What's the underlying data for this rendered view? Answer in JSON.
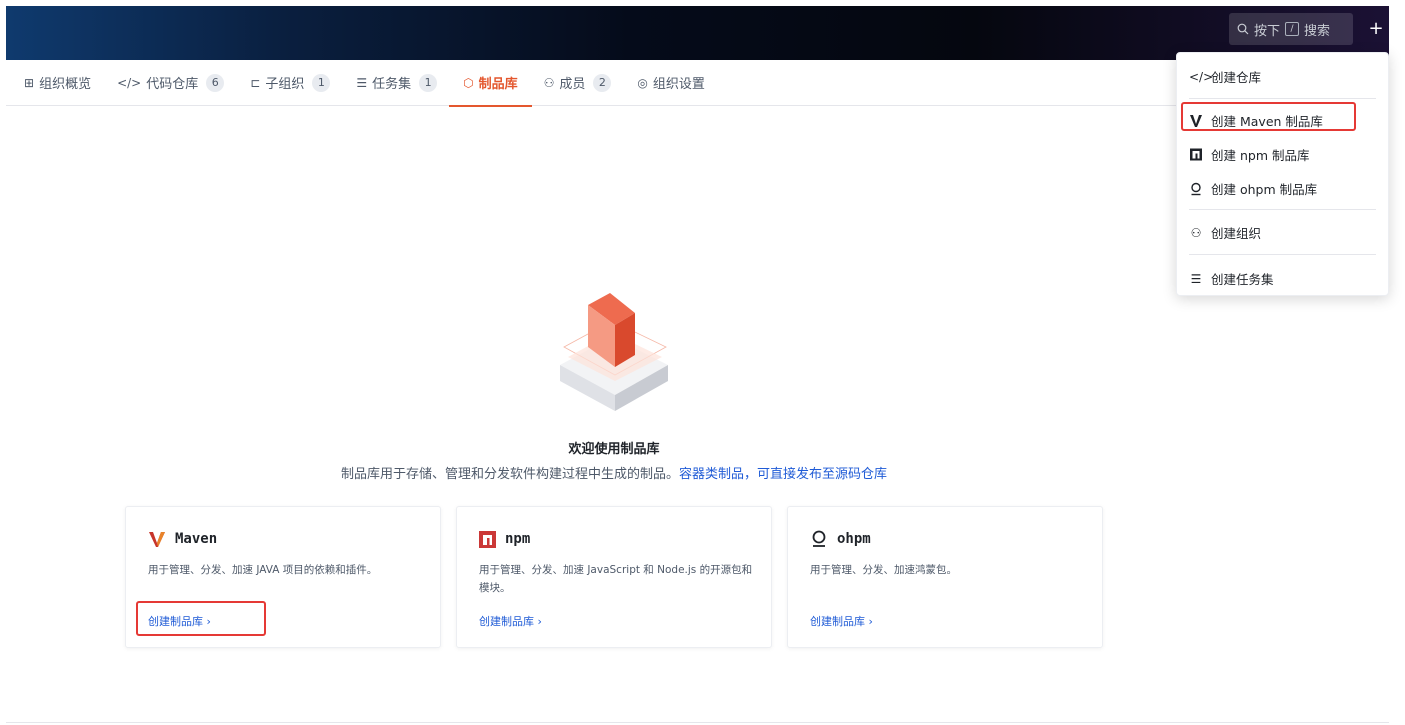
{
  "topbar": {
    "search_label": "按下",
    "search_key": "/",
    "search_text": "搜索",
    "plus_label": "+"
  },
  "tabs": [
    {
      "label": "组织概览",
      "icon": "grid-icon"
    },
    {
      "label": "代码仓库",
      "icon": "code-icon",
      "badge": "6"
    },
    {
      "label": "子组织",
      "icon": "hierarchy-icon",
      "badge": "1"
    },
    {
      "label": "任务集",
      "icon": "list-icon",
      "badge": "1"
    },
    {
      "label": "制品库",
      "icon": "package-icon",
      "active": true
    },
    {
      "label": "成员",
      "icon": "users-icon",
      "badge": "2"
    },
    {
      "label": "组织设置",
      "icon": "settings-icon"
    }
  ],
  "welcome": {
    "title": "欢迎使用制品库",
    "desc": "制品库用于存储、管理和分发软件构建过程中生成的制品。",
    "link": "容器类制品，可直接发布至源码仓库"
  },
  "cards": [
    {
      "name": "Maven",
      "desc": "用于管理、分发、加速 JAVA 项目的依赖和插件。",
      "link": "创建制品库 ›",
      "icon": "maven-icon"
    },
    {
      "name": "npm",
      "desc": "用于管理、分发、加速 JavaScript 和 Node.js 的开源包和模块。",
      "link": "创建制品库 ›",
      "icon": "npm-icon"
    },
    {
      "name": "ohpm",
      "desc": "用于管理、分发、加速鸿蒙包。",
      "link": "创建制品库 ›",
      "icon": "ohpm-icon"
    }
  ],
  "menu": {
    "create_repo": "创建仓库",
    "create_maven": "创建 Maven 制品库",
    "create_npm": "创建 npm 制品库",
    "create_ohpm": "创建 ohpm 制品库",
    "create_org": "创建组织",
    "create_taskset": "创建任务集"
  },
  "colors": {
    "accent": "#e4572e",
    "link": "#1f5bd6",
    "highlight": "#e53935"
  }
}
